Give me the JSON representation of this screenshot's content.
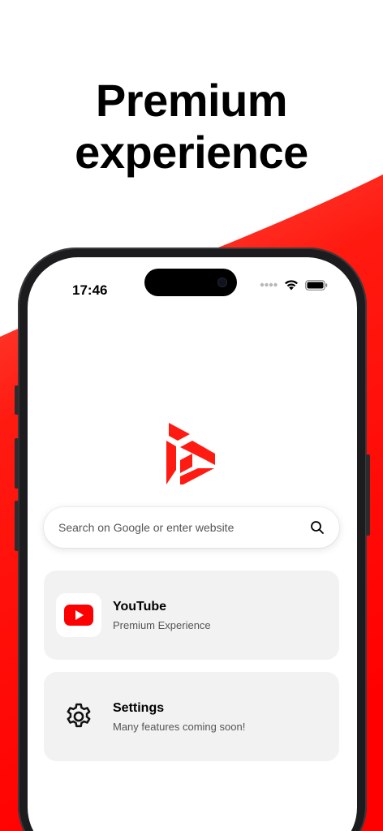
{
  "headline": {
    "line1": "Premium",
    "line2": "experience"
  },
  "colors": {
    "accent": "#ff0000",
    "background": "#ffffff",
    "card": "#f2f2f2"
  },
  "status_bar": {
    "time": "17:46",
    "icons": [
      "signal-dots-icon",
      "wifi-icon",
      "battery-icon"
    ]
  },
  "logo": {
    "icon": "brand-logo-icon"
  },
  "search": {
    "placeholder": "Search on Google or enter website",
    "icon": "search-icon"
  },
  "cards": [
    {
      "title": "YouTube",
      "subtitle": "Premium Experience",
      "icon": "youtube-icon"
    },
    {
      "title": "Settings",
      "subtitle": "Many features coming soon!",
      "icon": "gear-icon"
    }
  ]
}
